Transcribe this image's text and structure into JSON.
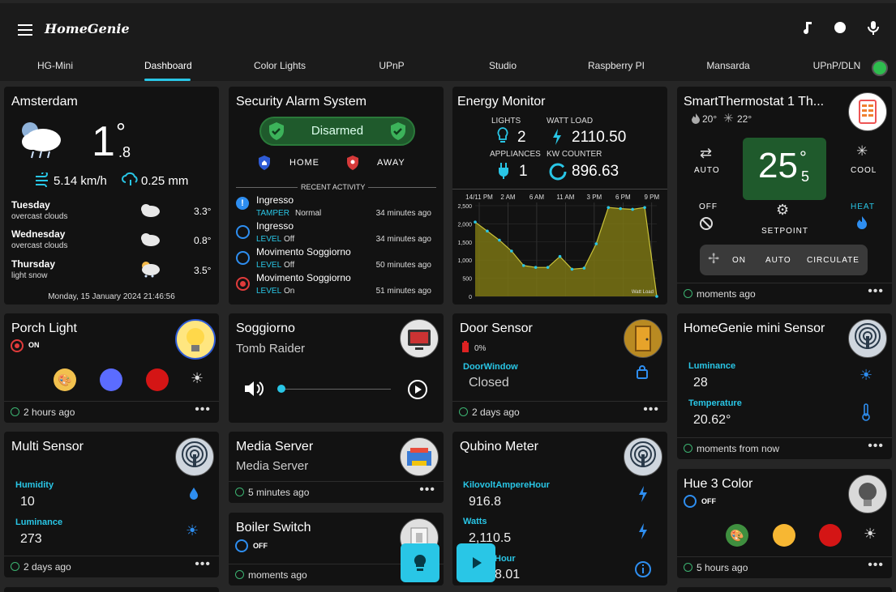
{
  "app": {
    "brand": "HomeGenie"
  },
  "tabs": [
    "HG-Mini",
    "Dashboard",
    "Color Lights",
    "UPnP",
    "Studio",
    "Raspberry PI",
    "Mansarda",
    "UPnP/DLN"
  ],
  "weather": {
    "city": "Amsterdam",
    "temp": "1",
    "temp_dec": ".8",
    "temp_unit": "°",
    "wind": "5.14 km/h",
    "rain": "0.25 mm",
    "forecast": [
      {
        "day": "Tuesday",
        "desc": "overcast clouds",
        "temp": "3.3°"
      },
      {
        "day": "Wednesday",
        "desc": "overcast clouds",
        "temp": "0.8°"
      },
      {
        "day": "Thursday",
        "desc": "light snow",
        "temp": "3.5°"
      }
    ],
    "date": "Monday, 15 January 2024 21:46:56"
  },
  "alarm": {
    "title": "Security Alarm System",
    "status": "Disarmed",
    "home": "HOME",
    "away": "AWAY",
    "recent_label": "RECENT ACTIVITY",
    "activity": [
      {
        "name": "Ingresso",
        "prop": "TAMPER",
        "value": "Normal",
        "time": "34 minutes ago"
      },
      {
        "name": "Ingresso",
        "prop": "LEVEL",
        "value": "Off",
        "time": "34 minutes ago"
      },
      {
        "name": "Movimento Soggiorno",
        "prop": "LEVEL",
        "value": "Off",
        "time": "50 minutes ago"
      },
      {
        "name": "Movimento Soggiorno",
        "prop": "LEVEL",
        "value": "On",
        "time": "51 minutes ago"
      }
    ]
  },
  "energy": {
    "title": "Energy Monitor",
    "lights_label": "LIGHTS",
    "lights": "2",
    "watt_label": "WATT LOAD",
    "watt": "2110.50",
    "appliances_label": "APPLIANCES",
    "appliances": "1",
    "kw_label": "KW COUNTER",
    "kw": "896.63",
    "legend": "Watt Load"
  },
  "chart_data": {
    "type": "area",
    "x": [
      "14/11 PM",
      "2 AM",
      "6 AM",
      "11 AM",
      "3 PM",
      "6 PM",
      "9 PM"
    ],
    "yticks": [
      "2,500",
      "2,000",
      "1,500",
      "1,000",
      "500",
      "0"
    ],
    "ylim": [
      0,
      2500
    ],
    "series": [
      {
        "name": "Watt Load",
        "values": [
          2050,
          1800,
          1550,
          1250,
          850,
          800,
          800,
          1100,
          750,
          780,
          1450,
          2450,
          2420,
          2400,
          2450,
          0
        ]
      }
    ],
    "grid": true
  },
  "thermostat": {
    "title": "SmartThermostat 1 Th...",
    "heat": "20°",
    "cool": "22°",
    "auto": "AUTO",
    "cool_label": "COOL",
    "temp": "25",
    "temp_dec": "5",
    "deg": "°",
    "off": "OFF",
    "heat_label": "HEAT",
    "setpoint": "SETPOINT",
    "fan_on": "ON",
    "fan_auto": "AUTO",
    "fan_circ": "CIRCULATE",
    "updated": "moments ago"
  },
  "porch": {
    "title": "Porch Light",
    "status": "ON",
    "updated": "2 hours ago",
    "colors": [
      "#f2c14e",
      "#5b6cff",
      "#d91b1b"
    ]
  },
  "soggiorno": {
    "title": "Soggiorno",
    "subtitle": "Tomb Raider"
  },
  "door": {
    "title": "Door Sensor",
    "battery": "0%",
    "label": "DoorWindow",
    "value": "Closed",
    "updated": "2 days ago"
  },
  "mini": {
    "title": "HomeGenie mini Sensor",
    "lum_label": "Luminance",
    "lum": "28",
    "temp_label": "Temperature",
    "temp": "20.62°",
    "updated": "moments from now"
  },
  "multi": {
    "title": "Multi Sensor",
    "hum_label": "Humidity",
    "hum": "10",
    "lum_label": "Luminance",
    "lum": "273",
    "updated": "2 days ago"
  },
  "media": {
    "title": "Media Server",
    "subtitle": "Media Server",
    "updated": "5 minutes ago"
  },
  "boiler": {
    "title": "Boiler Switch",
    "status": "OFF",
    "updated": "moments ago"
  },
  "qubino": {
    "title": "Qubino Meter",
    "kvah_label": "KilovoltAmpereHour",
    "kvah": "916.8",
    "watts_label": "Watts",
    "watts": "2,110.5",
    "hour_label": "Hour",
    "hour": "8.01"
  },
  "hue": {
    "title": "Hue 3 Color",
    "status": "OFF",
    "updated": "5 hours ago",
    "colors": [
      "#3f8f3f",
      "#f7b733",
      "#d91b1b"
    ]
  }
}
